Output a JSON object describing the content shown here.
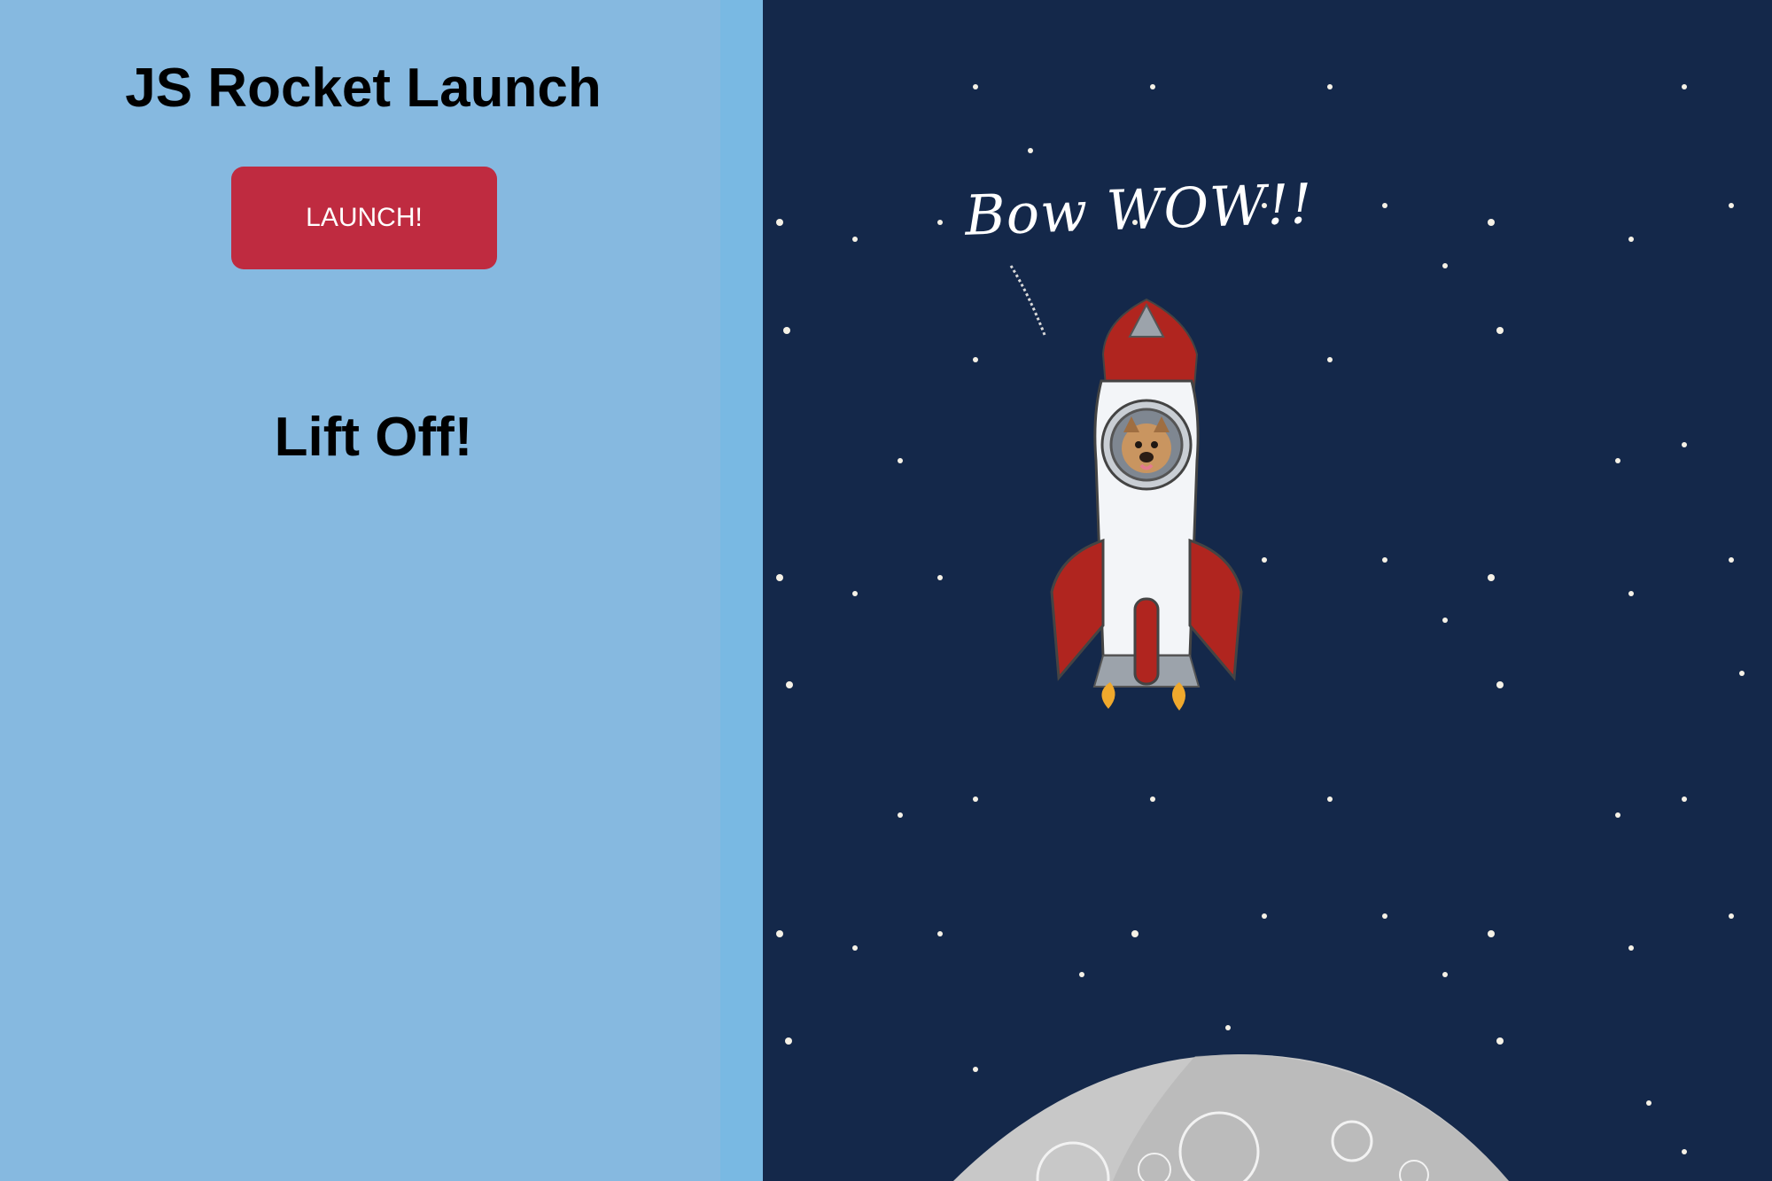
{
  "app": {
    "title": "JS Rocket Launch"
  },
  "controls": {
    "launch_label": "LAUNCH!"
  },
  "status": {
    "message": "Lift Off!"
  },
  "scene": {
    "speech_text": "Bow WOW!!",
    "rocket_icon": "rocket-icon",
    "dog_icon": "dog-icon",
    "moon_icon": "moon-icon"
  },
  "colors": {
    "left_panel": "#86b9e0",
    "divider": "#79b9e3",
    "space": "#14284a",
    "button": "#bf2b40",
    "rocket_red": "#b0251f",
    "rocket_white": "#f3f5f8",
    "moon": "#c8c8c8"
  }
}
